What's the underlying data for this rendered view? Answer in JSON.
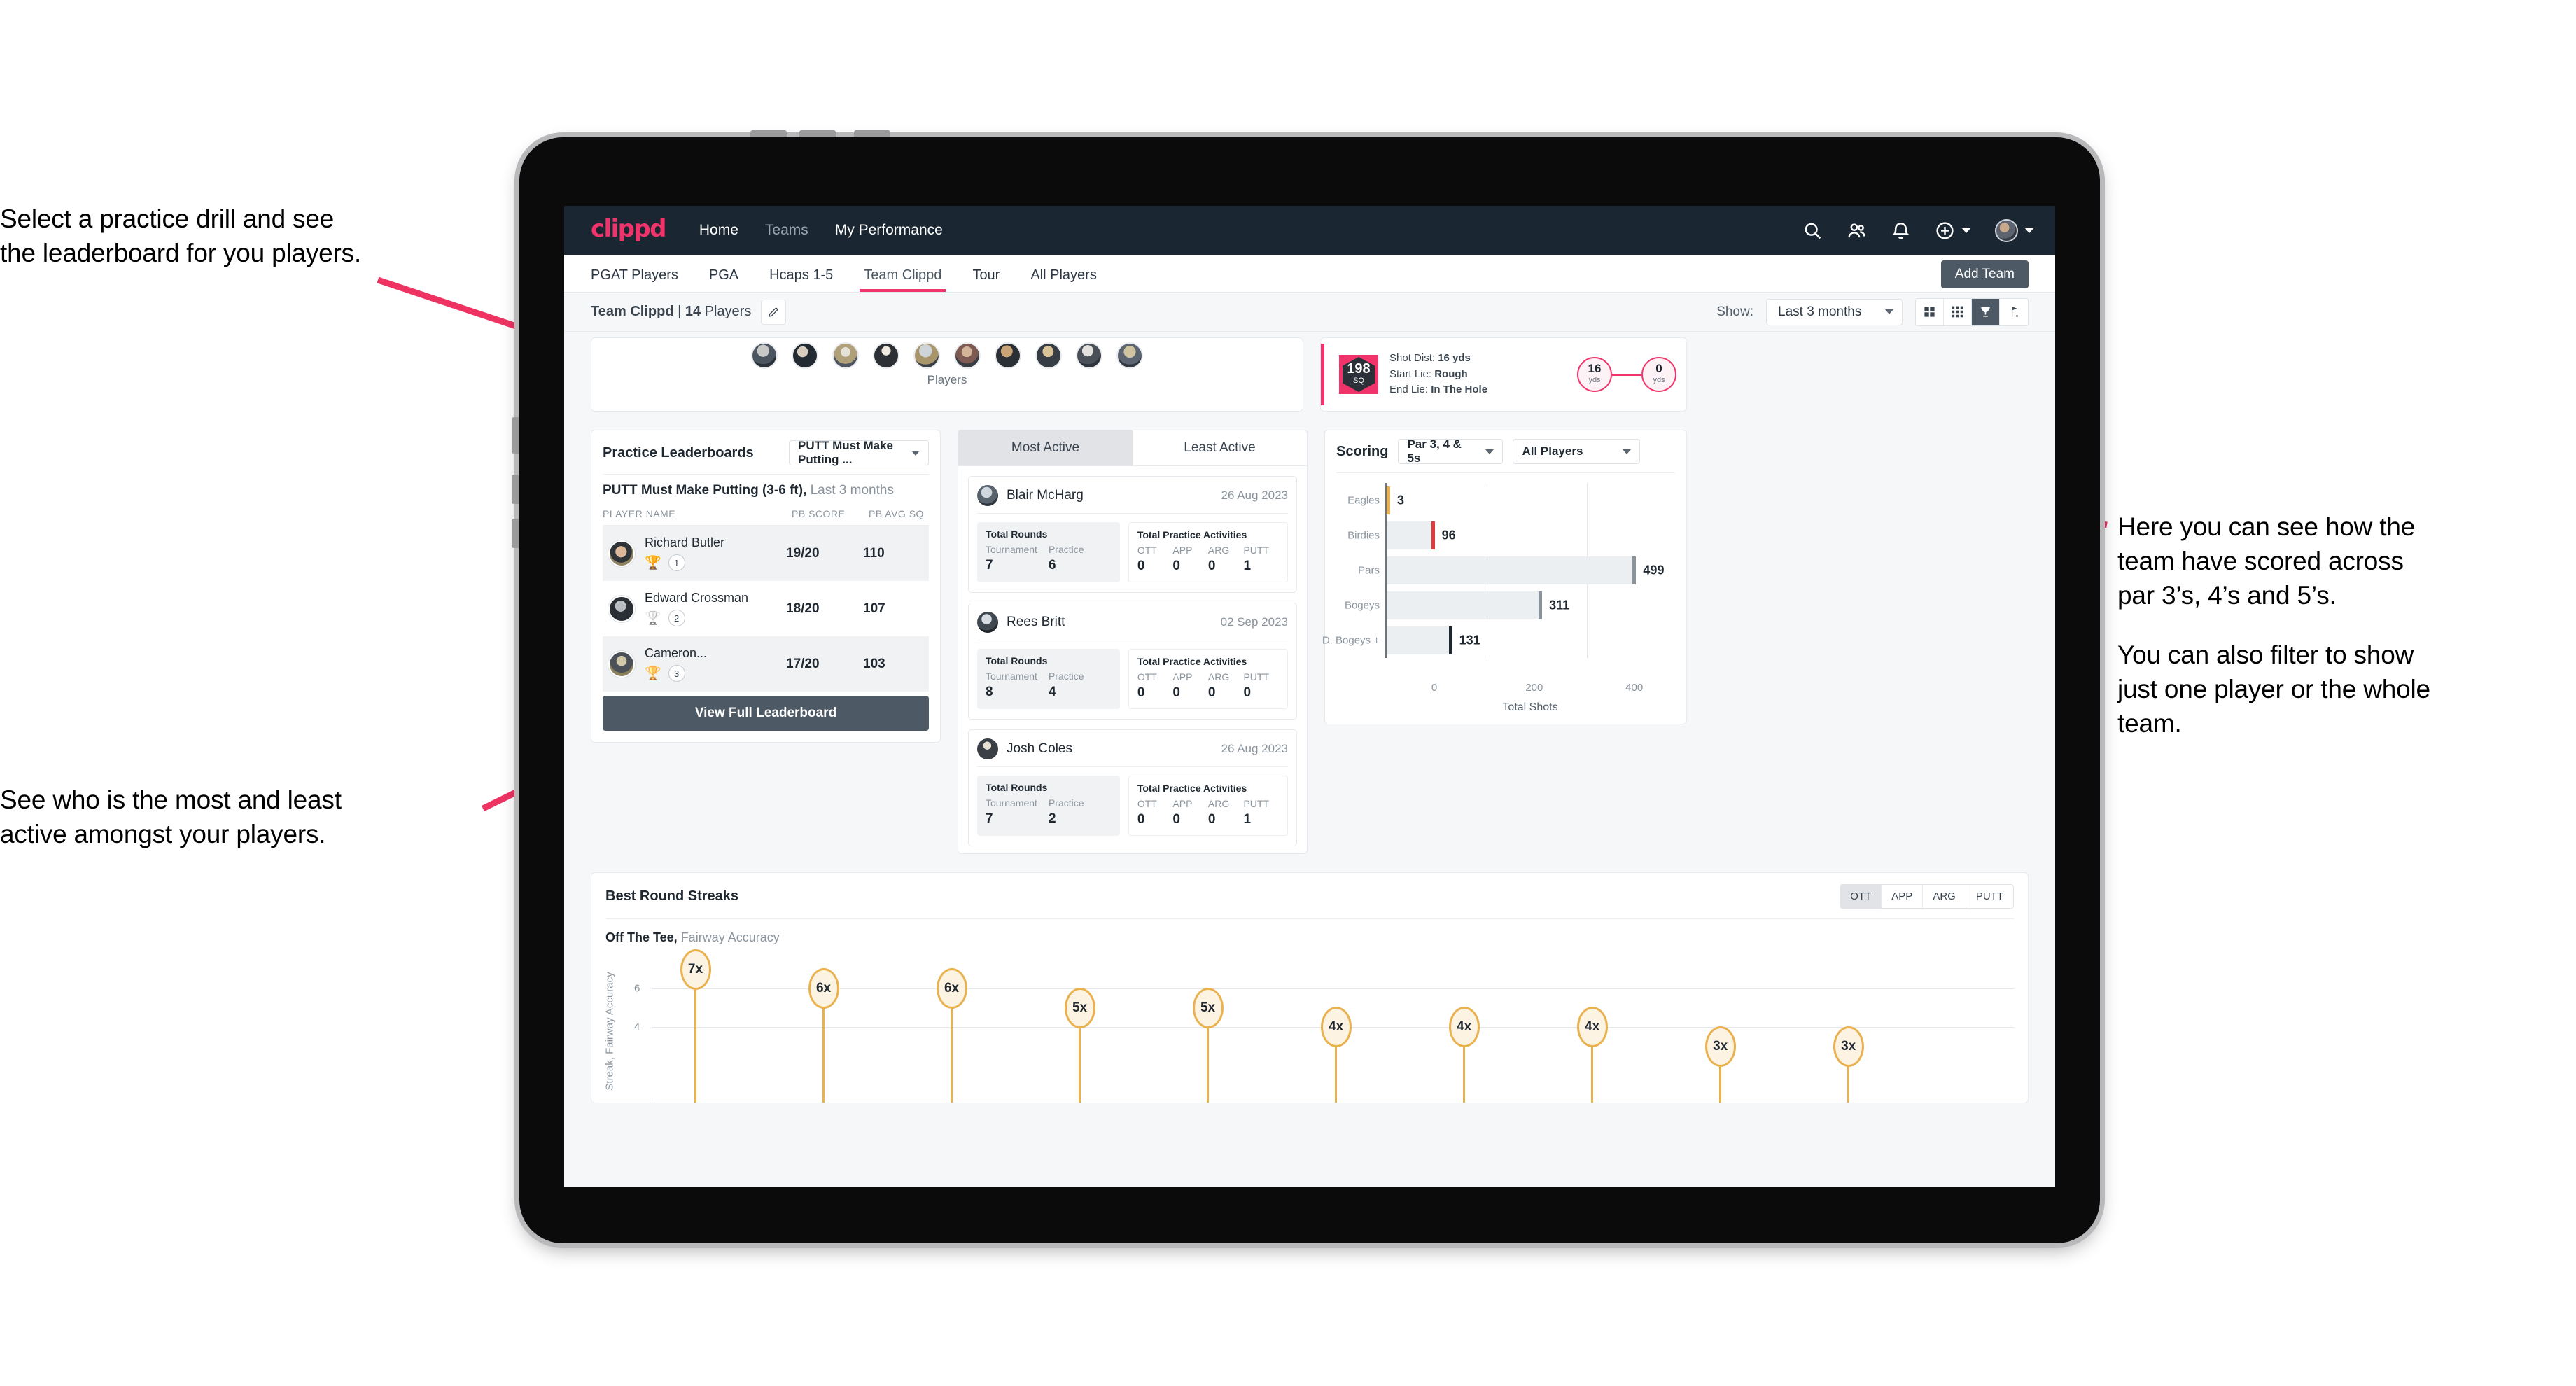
{
  "annotations": {
    "top_left": [
      "Select a practice drill and see",
      "the leaderboard for you players."
    ],
    "bottom_left": [
      "See who is the most and least",
      "active amongst your players."
    ],
    "right_1": [
      "Here you can see how the",
      "team have scored across",
      "par 3’s, 4’s and 5’s."
    ],
    "right_2": [
      "You can also filter to show",
      "just one player or the whole",
      "team."
    ]
  },
  "navbar": {
    "brand": "clippd",
    "links": [
      {
        "label": "Home",
        "dim": false
      },
      {
        "label": "Teams",
        "dim": true
      },
      {
        "label": "My Performance",
        "dim": false
      }
    ],
    "icons": [
      "search-icon",
      "people-icon",
      "bell-icon",
      "plus-circle-icon",
      "avatar"
    ]
  },
  "tabs": {
    "items": [
      {
        "label": "PGAT Players",
        "active": false
      },
      {
        "label": "PGA",
        "active": false
      },
      {
        "label": "Hcaps 1-5",
        "active": false
      },
      {
        "label": "Team Clippd",
        "active": true
      },
      {
        "label": "Tour",
        "active": false
      },
      {
        "label": "All Players",
        "active": false
      }
    ],
    "add_team_label": "Add Team"
  },
  "toolbar": {
    "team_name": "Team Clippd",
    "separator": " | ",
    "player_count": "14",
    "players_word": " Players",
    "edit_icon": "pencil-icon",
    "show_label": "Show:",
    "range_value": "Last 3 months",
    "view_toggles": [
      {
        "name": "grid-large-icon",
        "active": false
      },
      {
        "name": "grid-small-icon",
        "active": false
      },
      {
        "name": "trophy-icon",
        "active": true
      },
      {
        "name": "flag-icon",
        "active": false
      }
    ]
  },
  "players_card": {
    "caption": "Players",
    "avatar_count": 10
  },
  "shot_card": {
    "badge_value": "198",
    "badge_unit": "SQ",
    "lines": [
      {
        "label": "Shot Dist: ",
        "value": "16 yds"
      },
      {
        "label": "Start Lie: ",
        "value": "Rough"
      },
      {
        "label": "End Lie: ",
        "value": "In The Hole"
      }
    ],
    "start_yds": "16",
    "end_yds": "0",
    "yds_unit": "yds"
  },
  "leaderboard": {
    "title": "Practice Leaderboards",
    "drill_select": "PUTT Must Make Putting ...",
    "subtitle_bold": "PUTT Must Make Putting (3-6 ft),",
    "subtitle_dim": " Last 3 months",
    "columns": [
      "PLAYER NAME",
      "PB SCORE",
      "PB AVG SQ"
    ],
    "rows": [
      {
        "name": "Richard Butler",
        "trophy": "gold",
        "rank": "1",
        "pb_score": "19/20",
        "pb_avg_sq": "110"
      },
      {
        "name": "Edward Crossman",
        "trophy": "silver",
        "rank": "2",
        "pb_score": "18/20",
        "pb_avg_sq": "107"
      },
      {
        "name": "Cameron...",
        "trophy": "bronze",
        "rank": "3",
        "pb_score": "17/20",
        "pb_avg_sq": "103"
      }
    ],
    "button_label": "View Full Leaderboard"
  },
  "activity": {
    "tabs": [
      {
        "label": "Most Active",
        "active": true
      },
      {
        "label": "Least Active",
        "active": false
      }
    ],
    "rounds_title": "Total Rounds",
    "rounds_cols": [
      "Tournament",
      "Practice"
    ],
    "practice_title": "Total Practice Activities",
    "practice_cols": [
      "OTT",
      "APP",
      "ARG",
      "PUTT"
    ],
    "items": [
      {
        "name": "Blair McHarg",
        "date": "26 Aug 2023",
        "tournament": "7",
        "practice": "6",
        "ott": "0",
        "app": "0",
        "arg": "0",
        "putt": "1"
      },
      {
        "name": "Rees Britt",
        "date": "02 Sep 2023",
        "tournament": "8",
        "practice": "4",
        "ott": "0",
        "app": "0",
        "arg": "0",
        "putt": "0"
      },
      {
        "name": "Josh Coles",
        "date": "26 Aug 2023",
        "tournament": "7",
        "practice": "2",
        "ott": "0",
        "app": "0",
        "arg": "0",
        "putt": "1"
      }
    ]
  },
  "scoring": {
    "title": "Scoring",
    "par_select": "Par 3, 4 & 5s",
    "player_select": "All Players"
  },
  "streaks": {
    "title": "Best Round Streaks",
    "tabs": [
      {
        "label": "OTT",
        "active": true
      },
      {
        "label": "APP",
        "active": false
      },
      {
        "label": "ARG",
        "active": false
      },
      {
        "label": "PUTT",
        "active": false
      }
    ],
    "sub_bold": "Off The Tee,",
    "sub_dim": " Fairway Accuracy"
  },
  "chart_data": [
    {
      "type": "bar",
      "orientation": "horizontal",
      "title": "Scoring",
      "categories": [
        "Eagles",
        "Birdies",
        "Pars",
        "Bogeys",
        "D. Bogeys +"
      ],
      "values": [
        3,
        96,
        499,
        311,
        131
      ],
      "cap_colors": [
        "#eab14f",
        "#e03a3a",
        "#8b949d",
        "#8b949d",
        "#1f2830"
      ],
      "xlabel": "Total Shots",
      "ylabel": "",
      "xticks": [
        0,
        200,
        400
      ],
      "xlim": [
        0,
        560
      ],
      "grid": true,
      "legend": "none"
    },
    {
      "type": "lollipop",
      "title": "Off The Tee, Fairway Accuracy",
      "ylabel": "Streak, Fairway Accuracy",
      "xlabel": "",
      "yticks": [
        4,
        6
      ],
      "ylim": [
        0,
        7.6
      ],
      "categories": [
        "p1",
        "p2",
        "p3",
        "p4",
        "p5",
        "p6",
        "p7",
        "p8",
        "p9",
        "p10"
      ],
      "values": [
        7,
        6,
        6,
        5,
        5,
        4,
        4,
        4,
        3,
        3
      ],
      "labels": [
        "7x",
        "6x",
        "6x",
        "5x",
        "5x",
        "4x",
        "4x",
        "4x",
        "3x",
        "3x"
      ],
      "color": "#eab14f",
      "grid": true
    }
  ]
}
